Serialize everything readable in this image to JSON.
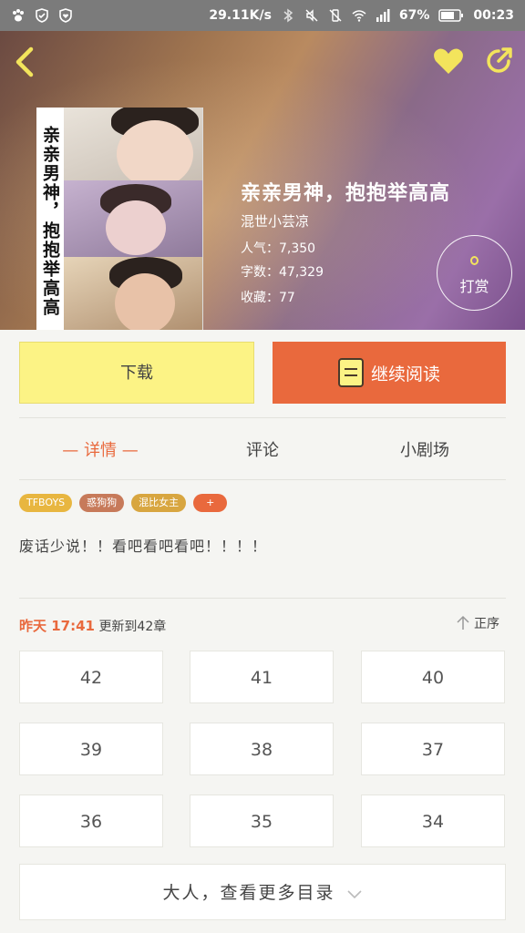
{
  "status_bar": {
    "speed": "29.11K/s",
    "battery": "67%",
    "time": "00:23"
  },
  "book": {
    "title": "亲亲男神，抱抱举高高",
    "cover_title": "亲亲男神，抱抱举高高",
    "author": "混世小芸凉",
    "popularity": "人气：7,350",
    "word_count": "字数：47,329",
    "favorites": "收藏：77"
  },
  "tip_label": "打赏",
  "actions": {
    "download": "下载",
    "continue": "继续阅读"
  },
  "tabs": [
    "— 详情 —",
    "评论",
    "小剧场"
  ],
  "tags": [
    {
      "label": "TFBOYS",
      "color": "#e8b640"
    },
    {
      "label": "惑狗狗",
      "color": "#c77a5a"
    },
    {
      "label": "混比女主",
      "color": "#d8a640"
    },
    {
      "label": "+",
      "color": "#e9693d"
    }
  ],
  "description": "废话少说！！看吧看吧看吧！！！！",
  "update": {
    "day": "昨天 17:41",
    "text": "更新到42章"
  },
  "sort_label": "正序",
  "chapters": [
    "42",
    "41",
    "40",
    "39",
    "38",
    "37",
    "36",
    "35",
    "34"
  ],
  "more_label": "大人，查看更多目录",
  "colors": {
    "accent": "#e9693d",
    "download_bg": "#fcf385"
  }
}
